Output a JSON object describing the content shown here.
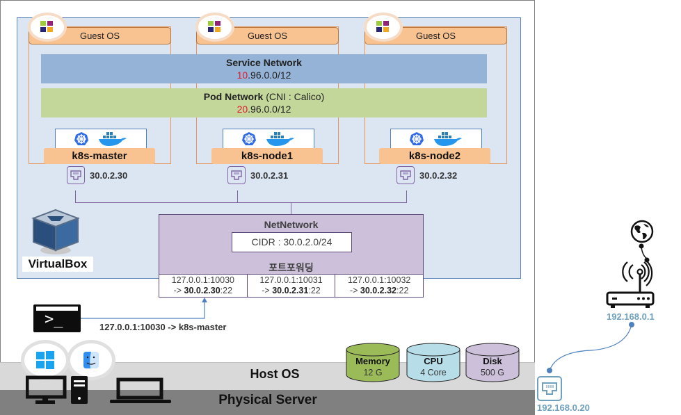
{
  "diagram": {
    "guest_os_label": "Guest OS",
    "service_network": {
      "title": "Service Network",
      "cidr_prefix": "10",
      "cidr_rest": ".96.0.0/12"
    },
    "pod_network": {
      "title": "Pod Network",
      "subtitle": " (CNI : Calico)",
      "cidr_prefix": "20",
      "cidr_rest": ".96.0.0/12"
    },
    "nodes": [
      {
        "name": "k8s-master",
        "ip": "30.0.2.30"
      },
      {
        "name": "k8s-node1",
        "ip": "30.0.2.31"
      },
      {
        "name": "k8s-node2",
        "ip": "30.0.2.32"
      }
    ],
    "nat_network": {
      "title": "NetNetwork",
      "cidr": "CIDR : 30.0.2.0/24",
      "port_forwarding_title": "포트포워딩",
      "rules": [
        {
          "from": "127.0.0.1:10030",
          "arrow": "-> ",
          "to_ip": "30.0.2.30",
          "to_port": ":22"
        },
        {
          "from": "127.0.0.1:10031",
          "arrow": "-> ",
          "to_ip": "30.0.2.31",
          "to_port": ":22"
        },
        {
          "from": "127.0.0.1:10032",
          "arrow": "-> ",
          "to_ip": "30.0.2.32",
          "to_port": ":22"
        }
      ]
    },
    "virtualbox_label": "VirtualBox",
    "terminal_prompt": ">_",
    "ssh_connection_label": "127.0.0.1:10030 ->  k8s-master",
    "host_os_label": "Host OS",
    "physical_server_label": "Physical Server",
    "resources": [
      {
        "name": "Memory",
        "value": "12 G",
        "color": "#9bbb59"
      },
      {
        "name": "CPU",
        "value": "4 Core",
        "color": "#b7dee8"
      },
      {
        "name": "Disk",
        "value": "500 G",
        "color": "#ccc0da"
      }
    ],
    "router_ip": "192.168.0.1",
    "host_ip": "192.168.0.20"
  },
  "colors": {
    "vbox_bg": "#dce6f2",
    "guest_header": "#f9c291",
    "service_net": "#95b3d7",
    "pod_net": "#c4d79b",
    "natnet": "#ccc0da",
    "cidr_highlight": "#e0192c",
    "host_ip_blue": "#6fa0bd"
  }
}
